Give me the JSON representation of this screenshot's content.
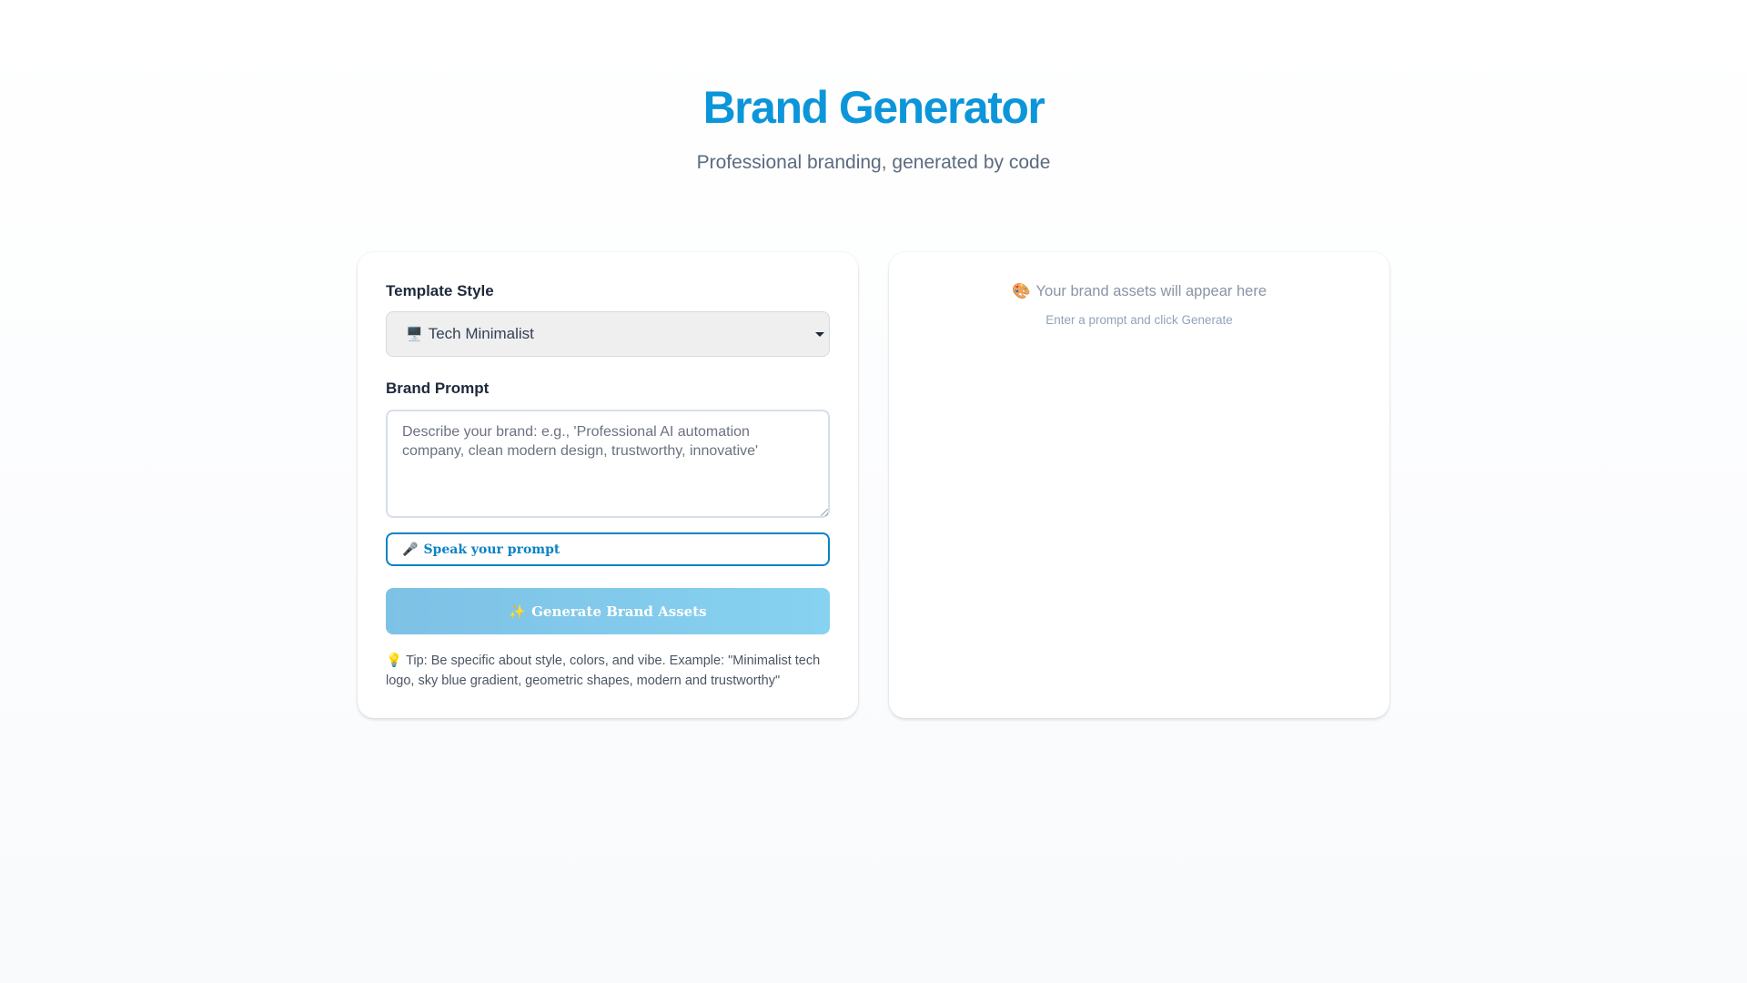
{
  "header": {
    "title": "Brand Generator",
    "subtitle": "Professional branding, generated by code"
  },
  "form": {
    "template_label": "Template Style",
    "template_selected_icon": "🖥️",
    "template_selected": "Tech Minimalist",
    "prompt_label": "Brand Prompt",
    "prompt_placeholder": "Describe your brand: e.g., 'Professional AI automation company, clean modern design, trustworthy, innovative'",
    "prompt_value": "",
    "speak_icon": "🎤",
    "speak_label": "Speak your prompt",
    "generate_icon": "✨",
    "generate_label": "Generate Brand Assets",
    "tip_icon": "💡",
    "tip_text": "Tip: Be specific about style, colors, and vibe. Example: \"Minimalist tech logo, sky blue gradient, geometric shapes, modern and trustworthy\""
  },
  "preview": {
    "icon": "🎨",
    "title": "Your brand assets will appear here",
    "subtitle": "Enter a prompt and click Generate"
  },
  "colors": {
    "brand": "#0c96d9",
    "accent_border": "#0c82c4",
    "generate_gradient_start": "#7ec1e6",
    "generate_gradient_end": "#86d2f0"
  }
}
